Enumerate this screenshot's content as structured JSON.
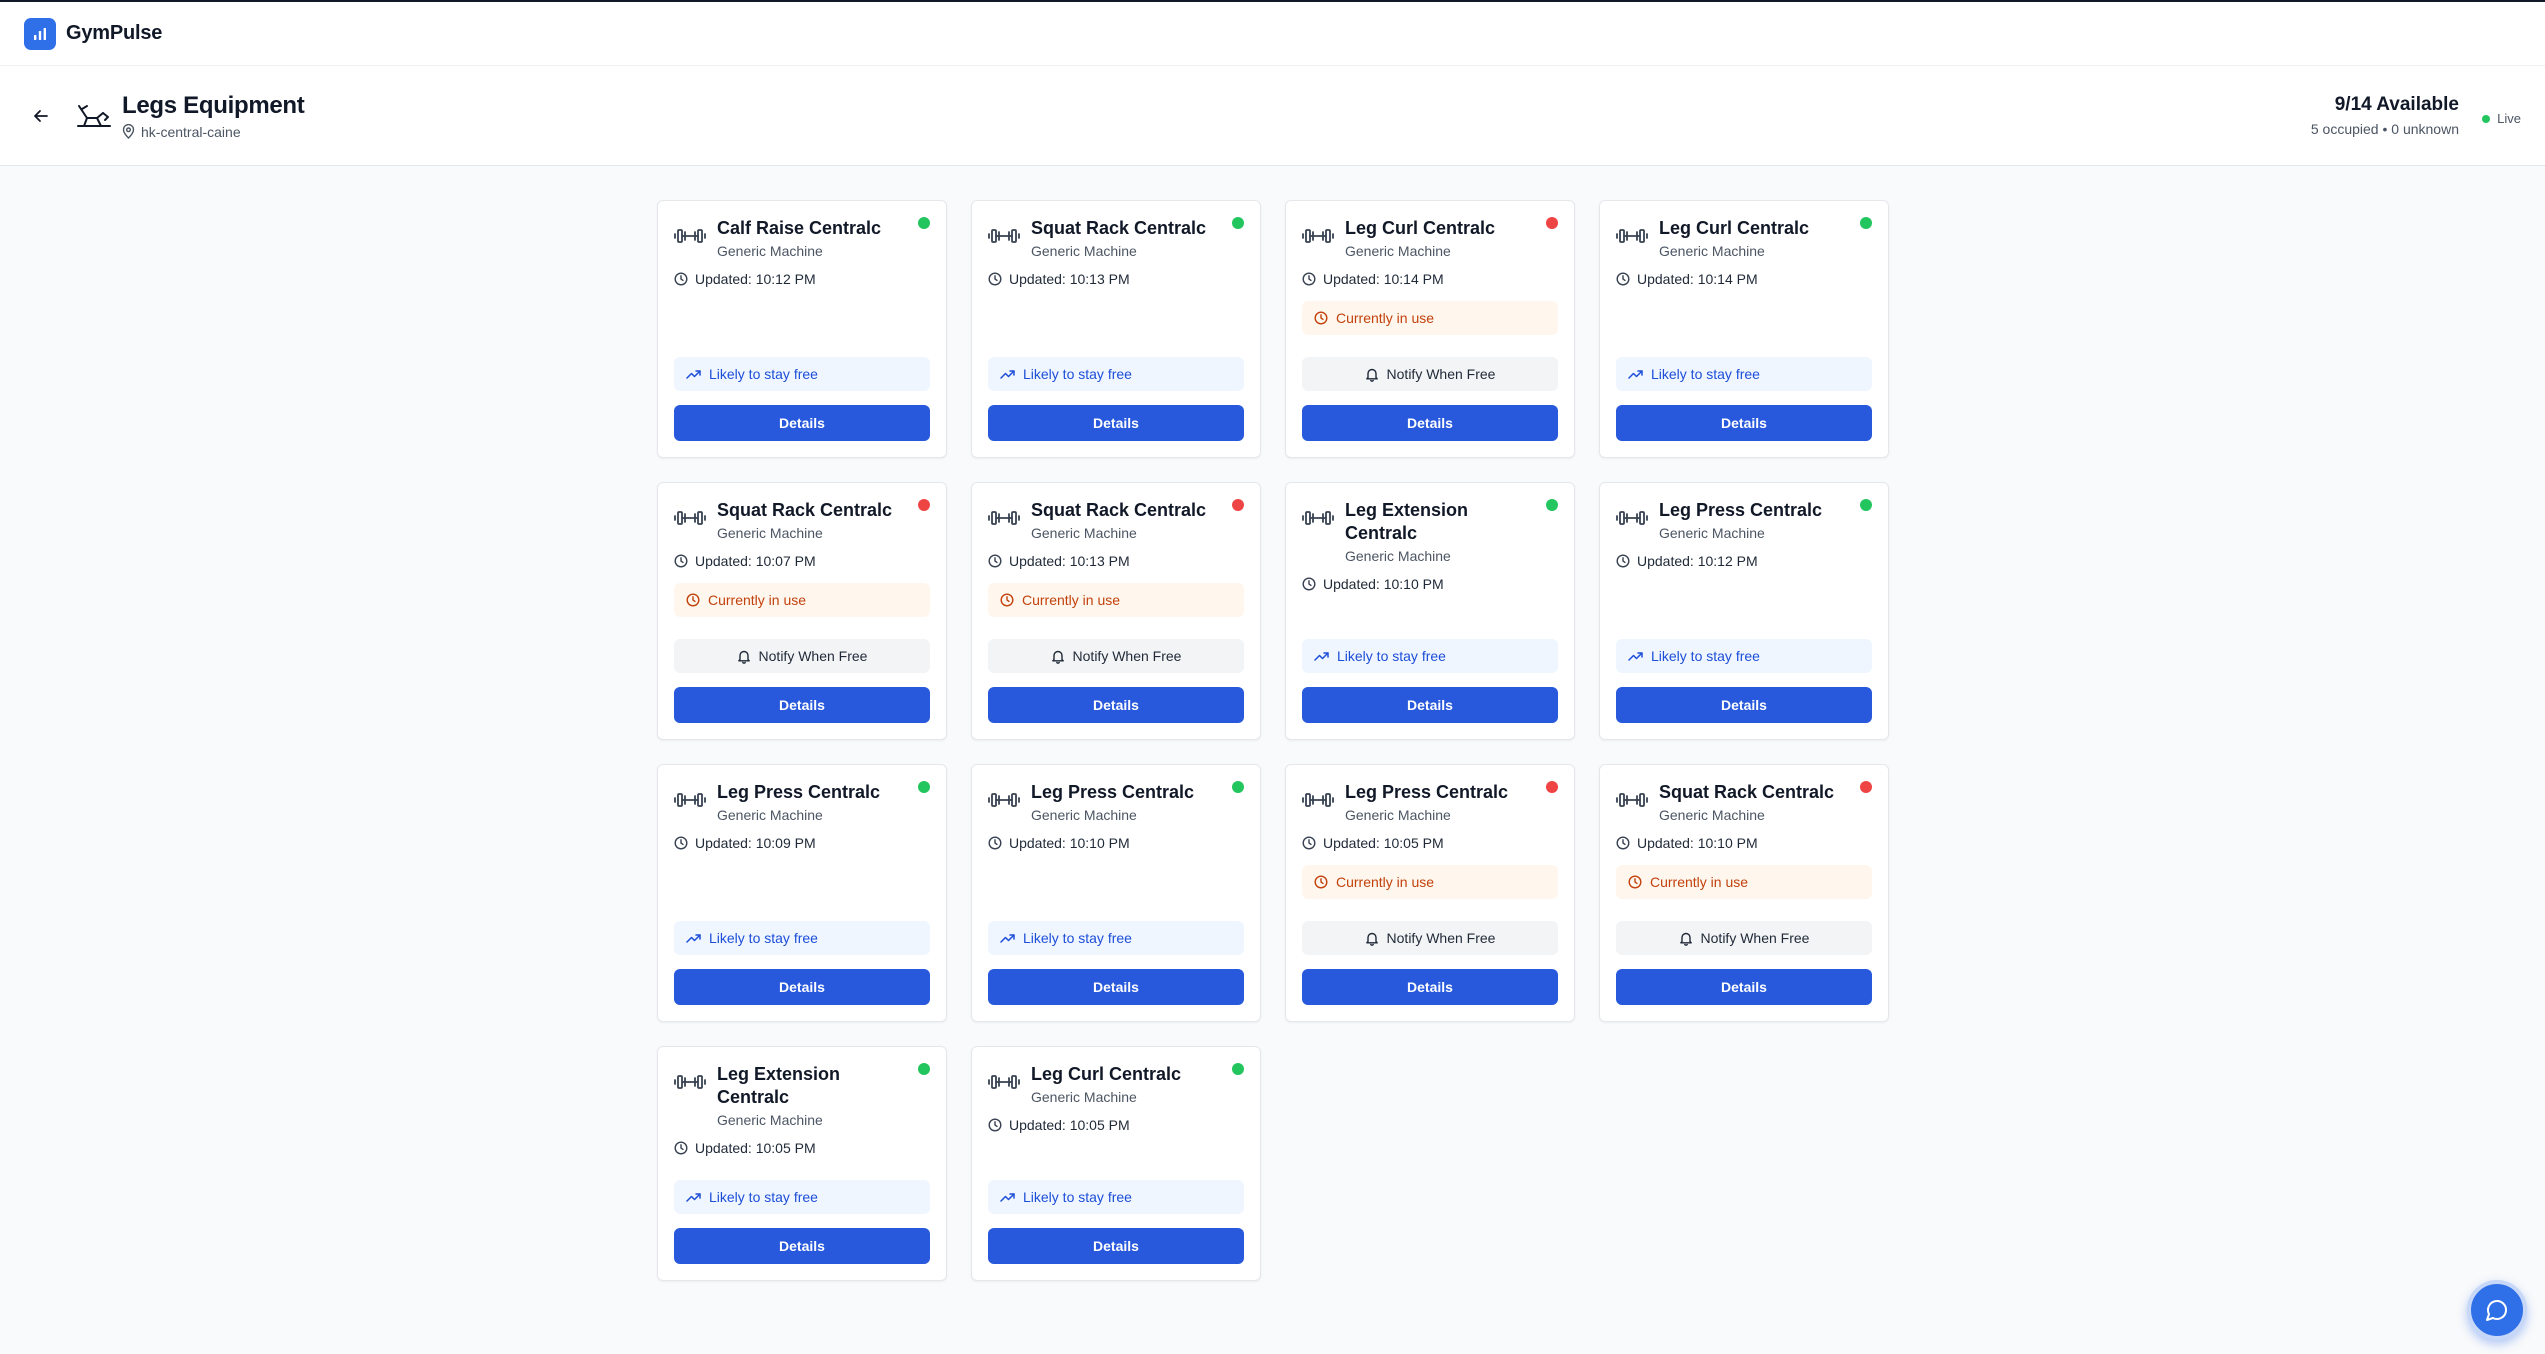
{
  "app": {
    "name": "GymPulse"
  },
  "page": {
    "title": "Legs Equipment",
    "location": "hk-central-caine",
    "availability": "9/14 Available",
    "occupancy_summary": "5 occupied • 0 unknown",
    "live_label": "Live"
  },
  "labels": {
    "free": "Likely to stay free",
    "busy": "Currently in use",
    "notify": "Notify When Free",
    "details": "Details"
  },
  "colors": {
    "accent": "#2859dc",
    "free": "#22c55e",
    "busy": "#ef4444"
  },
  "equipment": [
    {
      "name": "Calf Raise Centralc",
      "type": "Generic Machine",
      "updated": "Updated: 10:12 PM",
      "status": "free"
    },
    {
      "name": "Squat Rack Centralc",
      "type": "Generic Machine",
      "updated": "Updated: 10:13 PM",
      "status": "free"
    },
    {
      "name": "Leg Curl Centralc",
      "type": "Generic Machine",
      "updated": "Updated: 10:14 PM",
      "status": "busy"
    },
    {
      "name": "Leg Curl Centralc",
      "type": "Generic Machine",
      "updated": "Updated: 10:14 PM",
      "status": "free"
    },
    {
      "name": "Squat Rack Centralc",
      "type": "Generic Machine",
      "updated": "Updated: 10:07 PM",
      "status": "busy"
    },
    {
      "name": "Squat Rack Centralc",
      "type": "Generic Machine",
      "updated": "Updated: 10:13 PM",
      "status": "busy"
    },
    {
      "name": "Leg Extension Centralc",
      "type": "Generic Machine",
      "updated": "Updated: 10:10 PM",
      "status": "free"
    },
    {
      "name": "Leg Press Centralc",
      "type": "Generic Machine",
      "updated": "Updated: 10:12 PM",
      "status": "free"
    },
    {
      "name": "Leg Press Centralc",
      "type": "Generic Machine",
      "updated": "Updated: 10:09 PM",
      "status": "free"
    },
    {
      "name": "Leg Press Centralc",
      "type": "Generic Machine",
      "updated": "Updated: 10:10 PM",
      "status": "free"
    },
    {
      "name": "Leg Press Centralc",
      "type": "Generic Machine",
      "updated": "Updated: 10:05 PM",
      "status": "busy"
    },
    {
      "name": "Squat Rack Centralc",
      "type": "Generic Machine",
      "updated": "Updated: 10:10 PM",
      "status": "busy"
    },
    {
      "name": "Leg Extension Centralc",
      "type": "Generic Machine",
      "updated": "Updated: 10:05 PM",
      "status": "free"
    },
    {
      "name": "Leg Curl Centralc",
      "type": "Generic Machine",
      "updated": "Updated: 10:05 PM",
      "status": "free"
    }
  ]
}
